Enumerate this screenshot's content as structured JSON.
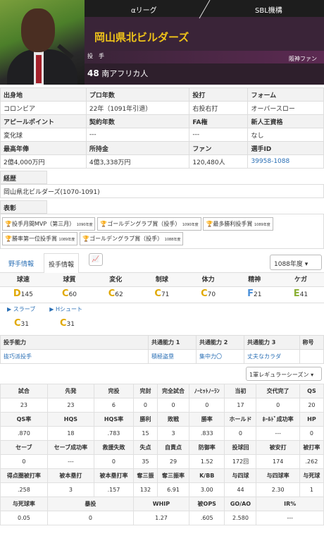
{
  "header": {
    "league": "αリーグ",
    "org": "SBL機構",
    "team": "岡山県北ビルダーズ",
    "position": "投　手",
    "fan_of": "阪神ファン",
    "number": "48",
    "name": "南アフリカ人"
  },
  "info": [
    {
      "label": "出身地",
      "value": "コロンビア"
    },
    {
      "label": "プロ年数",
      "value": "22年（1091年引退）"
    },
    {
      "label": "投打",
      "value": "右投右打"
    },
    {
      "label": "フォーム",
      "value": "オーバースロー"
    },
    {
      "label": "アピールポイント",
      "value": "変化球"
    },
    {
      "label": "契約年数",
      "value": "---"
    },
    {
      "label": "FA権",
      "value": "---"
    },
    {
      "label": "新人王資格",
      "value": "なし"
    },
    {
      "label": "最高年俸",
      "value": "2億4,000万円"
    },
    {
      "label": "所持金",
      "value": "4億3,338万円"
    },
    {
      "label": "ファン",
      "value": "120,480人"
    },
    {
      "label": "選手ID",
      "value": "39958-1088"
    }
  ],
  "career": {
    "label": "経歴",
    "value": "岡山県北ビルダーズ(1070-1091)"
  },
  "awards_label": "表彰",
  "awards": [
    {
      "name": "投手月間MVP（第三月）",
      "year": "1090年度"
    },
    {
      "name": "ゴールデングラブ賞（投手）",
      "year": "1090年度"
    },
    {
      "name": "最多勝利投手賞",
      "year": "1089年度"
    },
    {
      "name": "勝率第一位投手賞",
      "year": "1089年度"
    },
    {
      "name": "ゴールデングラブ賞（投手）",
      "year": "1088年度"
    }
  ],
  "tabs": {
    "fielder": "野手情報",
    "pitcher": "投手情報",
    "year": "1088年度",
    "chart_icon": "chart-line-icon"
  },
  "ratings": [
    {
      "label": "球速",
      "grade": "D",
      "value": "145",
      "color": "#e0a800"
    },
    {
      "label": "球質",
      "grade": "C",
      "value": "60",
      "color": "#e0a800"
    },
    {
      "label": "変化",
      "grade": "C",
      "value": "62",
      "color": "#e0a800"
    },
    {
      "label": "制球",
      "grade": "C",
      "value": "71",
      "color": "#e0a800"
    },
    {
      "label": "体力",
      "grade": "C",
      "value": "70",
      "color": "#e0a800"
    },
    {
      "label": "精神",
      "grade": "F",
      "value": "21",
      "color": "#4a90d9"
    },
    {
      "label": "ケガ",
      "grade": "E",
      "value": "41",
      "color": "#8ab034"
    }
  ],
  "pitches": [
    {
      "name": "スラーブ",
      "grade": "C",
      "value": "31"
    },
    {
      "name": "Hシュート",
      "grade": "C",
      "value": "31"
    }
  ],
  "abilities": {
    "headers": [
      "投手能力",
      "共通能力 1",
      "共通能力 2",
      "共通能力 3",
      "称号"
    ],
    "values": [
      "抜巧派投手",
      "積極盗塁",
      "集中力〇",
      "丈夫なカラダ",
      ""
    ]
  },
  "season": "1軍レギュラーシーズン",
  "stats": [
    {
      "headers": [
        "試合",
        "先発",
        "完投",
        "完封",
        "完全試合",
        "ﾉｰﾋｯﾄﾉｰﾗﾝ",
        "当初",
        "交代完了",
        "QS"
      ],
      "values": [
        "23",
        "23",
        "6",
        "0",
        "0",
        "0",
        "17",
        "0",
        "20"
      ]
    },
    {
      "headers": [
        "QS率",
        "HQS",
        "HQS率",
        "勝利",
        "敗戦",
        "勝率",
        "ホールド",
        "ﾎｰﾙﾄﾞ成功率",
        "HP"
      ],
      "values": [
        ".870",
        "18",
        ".783",
        "15",
        "3",
        ".833",
        "0",
        "---",
        "0"
      ]
    },
    {
      "headers": [
        "セーブ",
        "セーブ成功率",
        "救援失敗",
        "失点",
        "自責点",
        "防御率",
        "投球回",
        "被安打",
        "被打率"
      ],
      "values": [
        "0",
        "---",
        "0",
        "35",
        "29",
        "1.52",
        "172回",
        "174",
        ".262"
      ]
    },
    {
      "headers": [
        "得点圏被打率",
        "被本塁打",
        "被本塁打率",
        "奪三振",
        "奪三振率",
        "K/BB",
        "与四球",
        "与四球率",
        "与死球"
      ],
      "values": [
        ".258",
        "3",
        ".157",
        "132",
        "6.91",
        "3.00",
        "44",
        "2.30",
        "1"
      ]
    },
    {
      "headers": [
        "与死球率",
        "暴投",
        "WHIP",
        "被OPS",
        "GO/AO",
        "IR%"
      ],
      "values": [
        "0.05",
        "0",
        "1.27",
        ".605",
        "2.580",
        "---"
      ]
    }
  ]
}
